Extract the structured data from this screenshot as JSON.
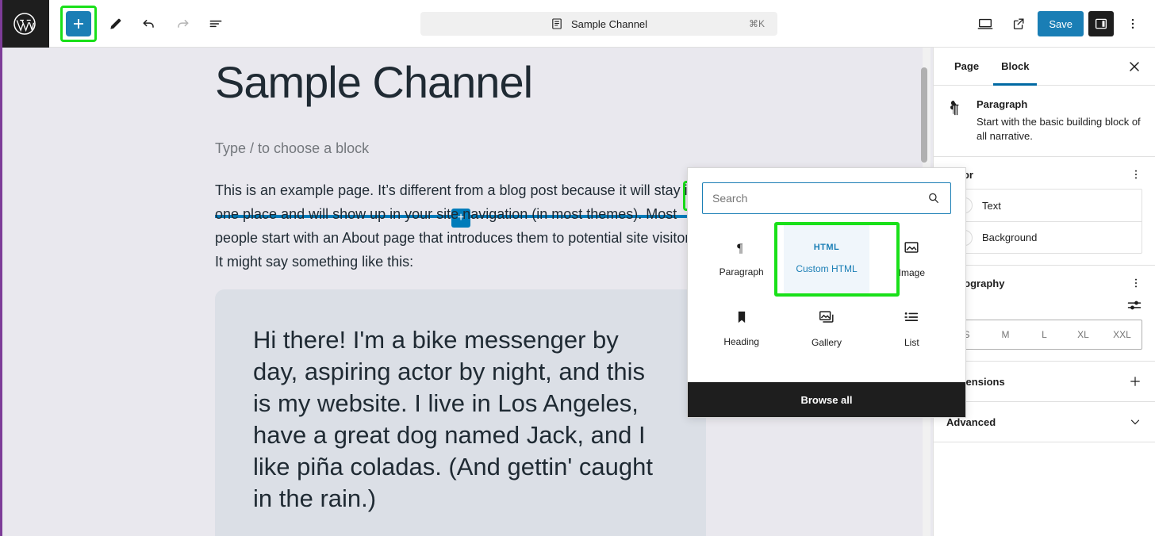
{
  "topbar": {
    "logo_icon": "wordpress-logo-icon",
    "add_block_label": "+",
    "tools": [
      {
        "name": "edit-tool-icon",
        "label": "Edit"
      },
      {
        "name": "undo-icon",
        "label": "Undo"
      },
      {
        "name": "redo-icon",
        "label": "Redo"
      },
      {
        "name": "document-overview-icon",
        "label": "Document Overview"
      }
    ],
    "command_bar": {
      "icon": "page-icon",
      "title": "Sample Channel",
      "shortcut": "⌘K"
    },
    "view_icon": "desktop-view-icon",
    "preview_icon": "external-link-icon",
    "save_label": "Save",
    "sidebar_toggle_icon": "settings-panel-icon",
    "more_menu_icon": "three-dots-vertical-icon"
  },
  "canvas": {
    "title": "Sample Channel",
    "empty_paragraph_placeholder": "Type / to choose a block",
    "block_inserter_label": "+",
    "insertion_point_label": "+",
    "body_paragraph": "This is an example page. It’s different from a blog post because it will stay in one place and will show up in your site navigation (in most themes). Most people start with an About page that introduces them to potential site visitors. It might say something like this:",
    "quote_text": "Hi there! I'm a bike messenger by day, aspiring actor by night, and this is my website. I live in Los Angeles, have a great dog named Jack, and I like piña coladas. (And gettin' caught in the rain.)"
  },
  "inserter_popover": {
    "search_placeholder": "Search",
    "search_value": "",
    "search_icon": "search-icon",
    "blocks": [
      {
        "label": "Paragraph",
        "icon": "paragraph-icon",
        "selected": false
      },
      {
        "label": "Custom HTML",
        "icon": "html-icon",
        "selected": true
      },
      {
        "label": "Image",
        "icon": "image-icon",
        "selected": false
      },
      {
        "label": "Heading",
        "icon": "heading-icon",
        "selected": false
      },
      {
        "label": "Gallery",
        "icon": "gallery-icon",
        "selected": false
      },
      {
        "label": "List",
        "icon": "list-icon",
        "selected": false
      }
    ],
    "browse_all_label": "Browse all"
  },
  "settings": {
    "tabs": [
      {
        "label": "Page",
        "active": false
      },
      {
        "label": "Block",
        "active": true
      }
    ],
    "close_icon": "close-icon",
    "block_card": {
      "icon": "paragraph-icon",
      "name": "Paragraph",
      "description": "Start with the basic building block of all narrative."
    },
    "color_panel": {
      "title": "Color",
      "options_icon": "three-dots-vertical-icon",
      "rows": [
        {
          "label": "Text"
        },
        {
          "label": "Background"
        }
      ]
    },
    "typography_panel": {
      "title": "Typography",
      "options_icon": "three-dots-vertical-icon",
      "tools_icon": "sliders-icon",
      "sizes": [
        "S",
        "M",
        "L",
        "XL",
        "XXL"
      ]
    },
    "dimensions_panel": {
      "title": "Dimensions",
      "add_icon": "plus-icon"
    },
    "advanced_panel": {
      "title": "Advanced",
      "chevron_icon": "chevron-down-icon"
    }
  },
  "colors": {
    "accent_blue": "#1a7eb5",
    "highlight_green": "#19e019",
    "dark": "#1e1e1e",
    "canvas_bg": "#e9e8ee",
    "quote_bg": "#dbdfe6"
  }
}
